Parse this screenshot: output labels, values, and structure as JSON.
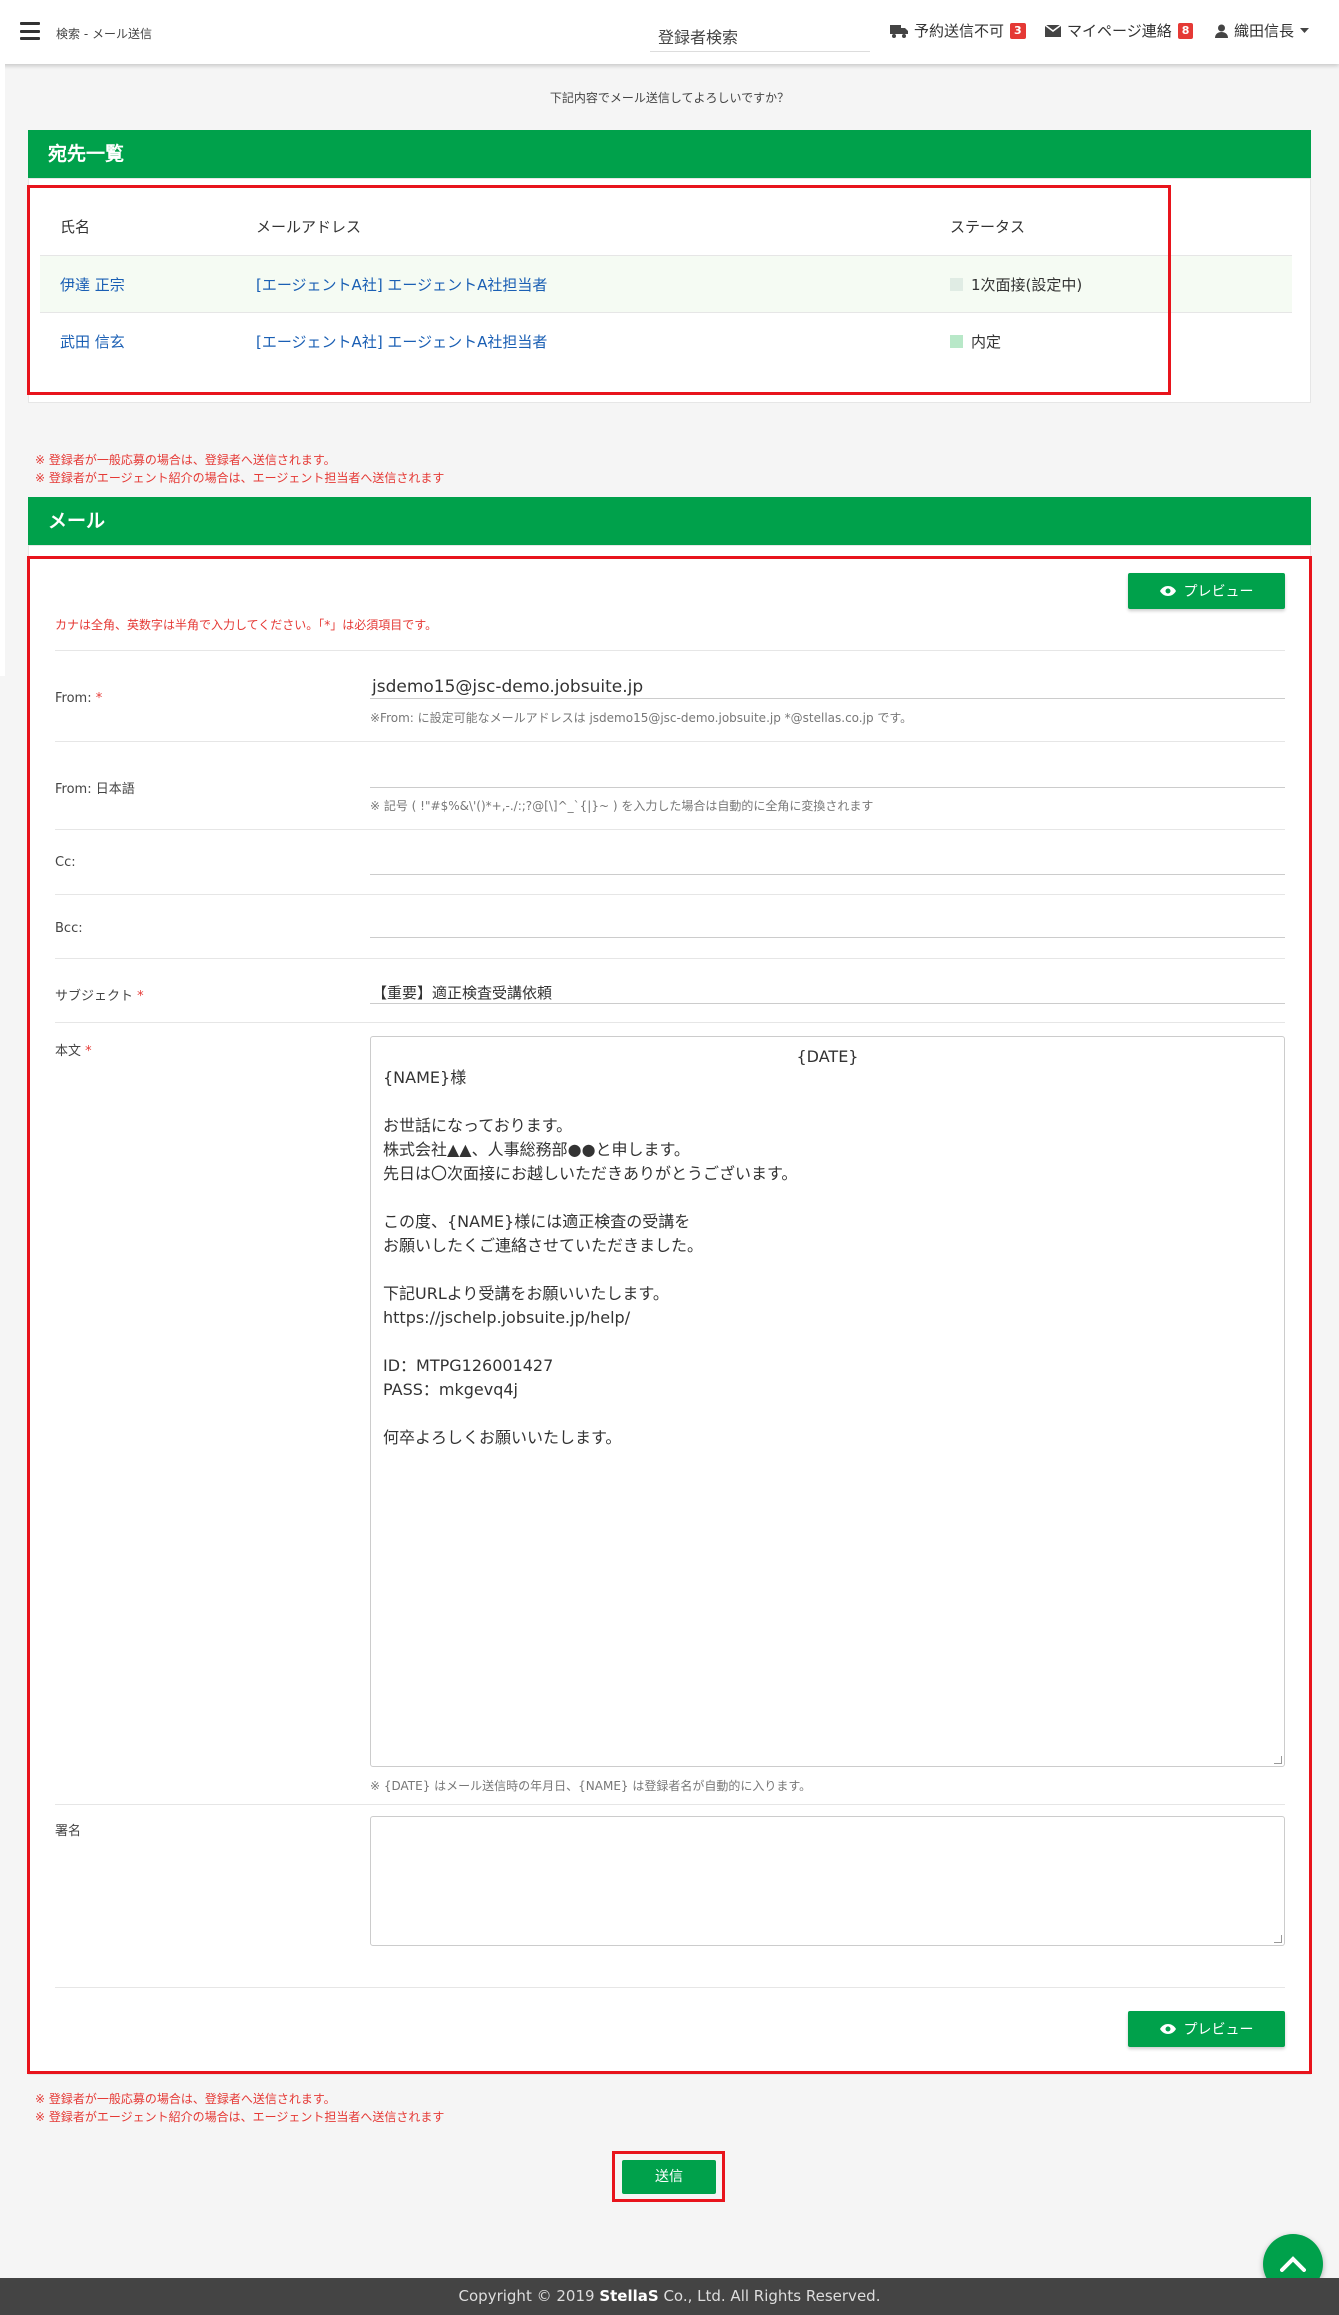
{
  "header": {
    "breadcrumb": "検索 - メール送信",
    "search_label": "登録者検索",
    "nav": [
      {
        "label": "予約送信不可",
        "badge": "3",
        "icon": "truck-icon"
      },
      {
        "label": "マイページ連絡",
        "badge": "8",
        "icon": "envelope-icon"
      },
      {
        "label": "織田信長",
        "icon": "user-icon"
      }
    ]
  },
  "confirm_message": "下記内容でメール送信してよろしいですか？",
  "recipients": {
    "title": "宛先一覧",
    "columns": [
      "氏名",
      "メールアドレス",
      "ステータス"
    ],
    "rows": [
      {
        "name": "伊達 正宗",
        "email": "[エージェントA社] エージェントA社担当者",
        "status": "1次面接(設定中)",
        "status_color": "#e0ece4"
      },
      {
        "name": "武田 信玄",
        "email": "[エージェントA社] エージェントA社担当者",
        "status": "内定",
        "status_color": "#b8e8c8"
      }
    ]
  },
  "notes": {
    "line1": "※ 登録者が一般応募の場合は、登録者へ送信されます。",
    "line2": "※ 登録者がエージェント紹介の場合は、エージェント担当者へ送信されます"
  },
  "mail": {
    "title": "メール",
    "preview_label": "プレビュー",
    "instruction": "カナは全角、英数字は半角で入力してください。「*」は必須項目です。",
    "from_label": "From:",
    "from_value": "jsdemo15@jsc-demo.jobsuite.jp",
    "from_help": "※From: に設定可能なメールアドレスは jsdemo15@jsc-demo.jobsuite.jp *@stellas.co.jp です。",
    "from_jp_label": "From: 日本語",
    "from_jp_help": "※ 記号 ( !\"#$%&\\'()*+,-./:;?@[\\]^_`{|}~ ) を入力した場合は自動的に全角に変換されます",
    "cc_label": "Cc:",
    "bcc_label": "Bcc:",
    "subject_label": "サブジェクト",
    "subject_value": "【重要】適正検査受講依頼",
    "body_label": "本文",
    "body_date": "{DATE}",
    "body_text": "{NAME}様\n\nお世話になっております。\n株式会社▲▲、人事総務部●●と申します。\n先日は〇次面接にお越しいただきありがとうございます。\n\nこの度、{NAME}様には適正検査の受講を\nお願いしたくご連絡させていただきました。\n\n下記URLより受講をお願いいたします。\nhttps://jschelp.jobsuite.jp/help/\n\nID：MTPG126001427\nPASS：mkgevq4j\n\n何卒よろしくお願いいたします。",
    "body_help": "※ {DATE} はメール送信時の年月日、{NAME} は登録者名が自動的に入ります。",
    "signature_label": "署名"
  },
  "send_label": "送信",
  "footer": {
    "prefix": "Copyright © 2019 ",
    "brand": "StellaS",
    "suffix": " Co., Ltd. All Rights Reserved."
  },
  "colors": {
    "accent": "#00a14b",
    "highlight": "#e8141c",
    "required": "#e53935"
  }
}
